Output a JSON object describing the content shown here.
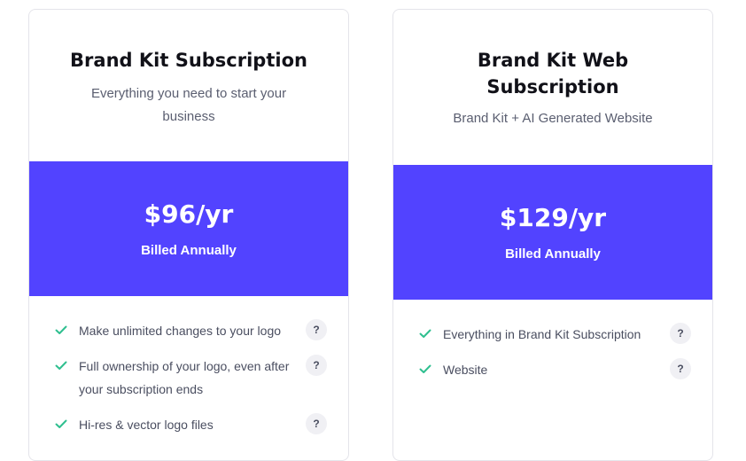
{
  "plans": [
    {
      "title": "Brand Kit Subscription",
      "subtitle": "Everything you need to start your business",
      "price": "$96/yr",
      "billing": "Billed Annually",
      "features": [
        "Make unlimited changes to your logo",
        "Full ownership of your logo, even after your subscription ends",
        "Hi-res & vector logo files"
      ]
    },
    {
      "title": "Brand Kit Web Subscription",
      "subtitle": "Brand Kit + AI Generated Website",
      "price": "$129/yr",
      "billing": "Billed Annually",
      "features": [
        "Everything in Brand Kit Subscription",
        "Website"
      ]
    }
  ],
  "help_label": "?",
  "icons": {
    "check": "check-icon",
    "help": "question-mark-icon"
  },
  "colors": {
    "accent": "#5243ff",
    "check": "#2fbf8f",
    "title": "#111118",
    "body_text": "#4a4e60",
    "help_bg": "#f0f0f4"
  }
}
